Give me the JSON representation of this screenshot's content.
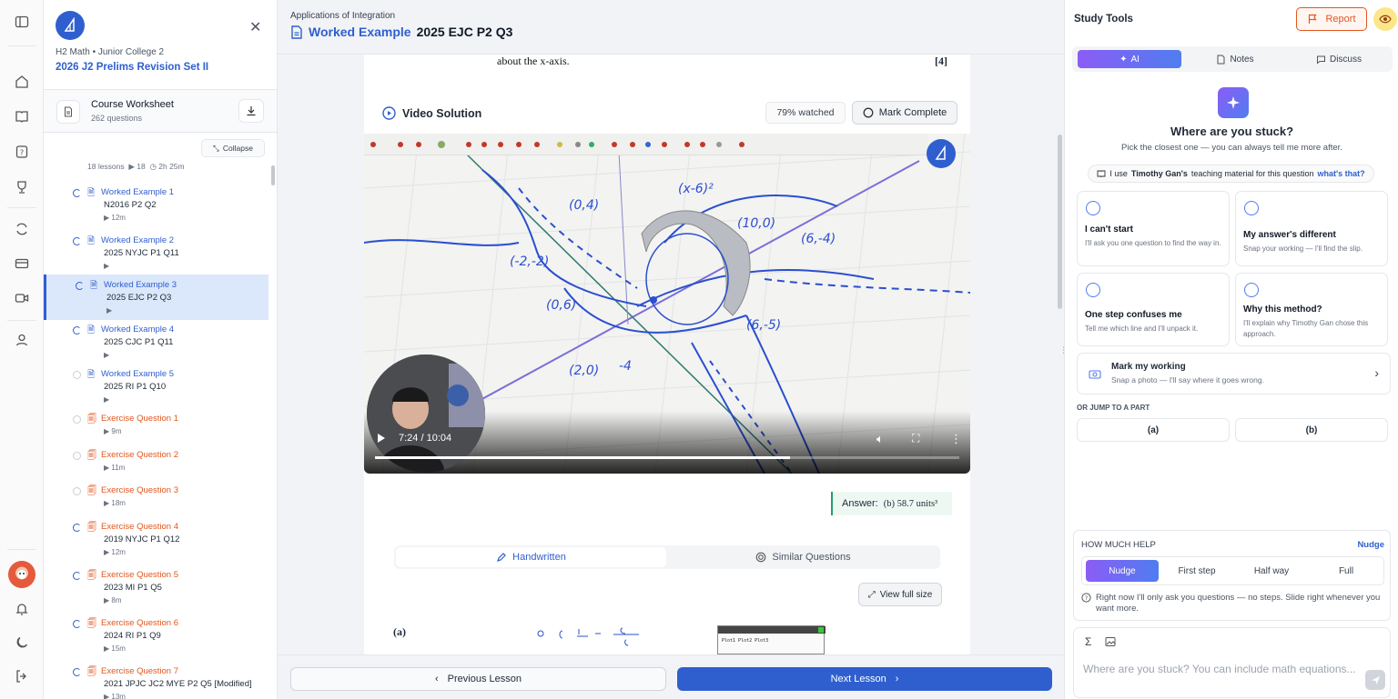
{
  "sidebar": {
    "subject": "H2 Math • Junior College 2",
    "set_title": "2026 J2 Prelims Revision Set II",
    "worksheet": {
      "title": "Course Worksheet",
      "count": "262 questions"
    },
    "collapse_label": "Collapse",
    "meta": {
      "lessons": "18 lessons",
      "videos": "18",
      "duration": "2h 25m"
    },
    "items": [
      {
        "kind": "worked",
        "status": "progress",
        "title": "Worked Example 1",
        "code": "N2016 P2 Q2",
        "time": "12m",
        "active": false
      },
      {
        "kind": "worked",
        "status": "progress",
        "title": "Worked Example 2",
        "code": "2025 NYJC P1 Q11",
        "time": "",
        "active": false
      },
      {
        "kind": "worked",
        "status": "progress",
        "title": "Worked Example 3",
        "code": "2025 EJC P2 Q3",
        "time": "",
        "active": true
      },
      {
        "kind": "worked",
        "status": "progress",
        "title": "Worked Example 4",
        "code": "2025 CJC P1 Q11",
        "time": "",
        "active": false
      },
      {
        "kind": "worked",
        "status": "none",
        "title": "Worked Example 5",
        "code": "2025 RI P1 Q10",
        "time": "",
        "active": false
      },
      {
        "kind": "exercise",
        "status": "none",
        "title": "Exercise Question 1",
        "code": "",
        "time": "9m",
        "active": false
      },
      {
        "kind": "exercise",
        "status": "none",
        "title": "Exercise Question 2",
        "code": "",
        "time": "11m",
        "active": false
      },
      {
        "kind": "exercise",
        "status": "none",
        "title": "Exercise Question 3",
        "code": "",
        "time": "18m",
        "active": false
      },
      {
        "kind": "exercise",
        "status": "progress",
        "title": "Exercise Question 4",
        "code": "2019 NYJC P1 Q12",
        "time": "12m",
        "active": false
      },
      {
        "kind": "exercise",
        "status": "progress",
        "title": "Exercise Question 5",
        "code": "2023 MI P1 Q5",
        "time": "8m",
        "active": false
      },
      {
        "kind": "exercise",
        "status": "progress",
        "title": "Exercise Question 6",
        "code": "2024 RI P1 Q9",
        "time": "15m",
        "active": false
      },
      {
        "kind": "exercise",
        "status": "progress",
        "title": "Exercise Question 7",
        "code": "2021 JPJC JC2 MYE P2 Q5 [Modified]",
        "time": "13m",
        "active": false
      }
    ]
  },
  "main": {
    "breadcrumb": "Applications of Integration",
    "title_prefix": "Worked Example",
    "title_code": "2025 EJC P2 Q3",
    "question_tail": "about the x-axis.",
    "question_marks": "[4]",
    "video_solution": "Video Solution",
    "watched": "79% watched",
    "watched_fraction": 0.79,
    "mark_complete": "Mark Complete",
    "video": {
      "time": "7:24 / 10:04",
      "progress": 0.71
    },
    "answer": {
      "label": "Answer:",
      "value": "(b) 58.7 units³"
    },
    "tabs": [
      "Handwritten",
      "Similar Questions"
    ],
    "view_full": "View full size",
    "part_label": "(a)",
    "prev": "Previous Lesson",
    "next": "Next Lesson"
  },
  "panel": {
    "title": "Study Tools",
    "report": "Report",
    "tabs": [
      "AI",
      "Notes",
      "Discuss"
    ],
    "heading": "Where are you stuck?",
    "subheading": "Pick the closest one — you can always tell me more after.",
    "teacher_prefix": "I use",
    "teacher_name": "Timothy Gan's",
    "teacher_suffix": "teaching material for this question",
    "whats_that": "what's that?",
    "cards": [
      {
        "title": "I can't start",
        "desc": "I'll ask you one question to find the way in."
      },
      {
        "title": "My answer's different",
        "desc": "Snap your working — I'll find the slip."
      },
      {
        "title": "One step confuses me",
        "desc": "Tell me which line and I'll unpack it."
      },
      {
        "title": "Why this method?",
        "desc": "I'll explain why Timothy Gan chose this approach."
      }
    ],
    "mark_working": {
      "title": "Mark my working",
      "desc": "Snap a photo — I'll say where it goes wrong."
    },
    "jump_label": "OR JUMP TO A PART",
    "parts": [
      "(a)",
      "(b)"
    ],
    "help_label": "HOW MUCH HELP",
    "help_current": "Nudge",
    "levels": [
      "Nudge",
      "First step",
      "Half way",
      "Full"
    ],
    "help_hint": "Right now I'll only ask you questions — no steps. Slide right whenever you want more.",
    "chat_placeholder": "Where are you stuck? You can include math equations..."
  },
  "colors": {
    "accent": "#2f5fcf",
    "exercise": "#e2571e",
    "ai_gradient_start": "#8b5cf6",
    "ai_gradient_end": "#4f7df0"
  }
}
